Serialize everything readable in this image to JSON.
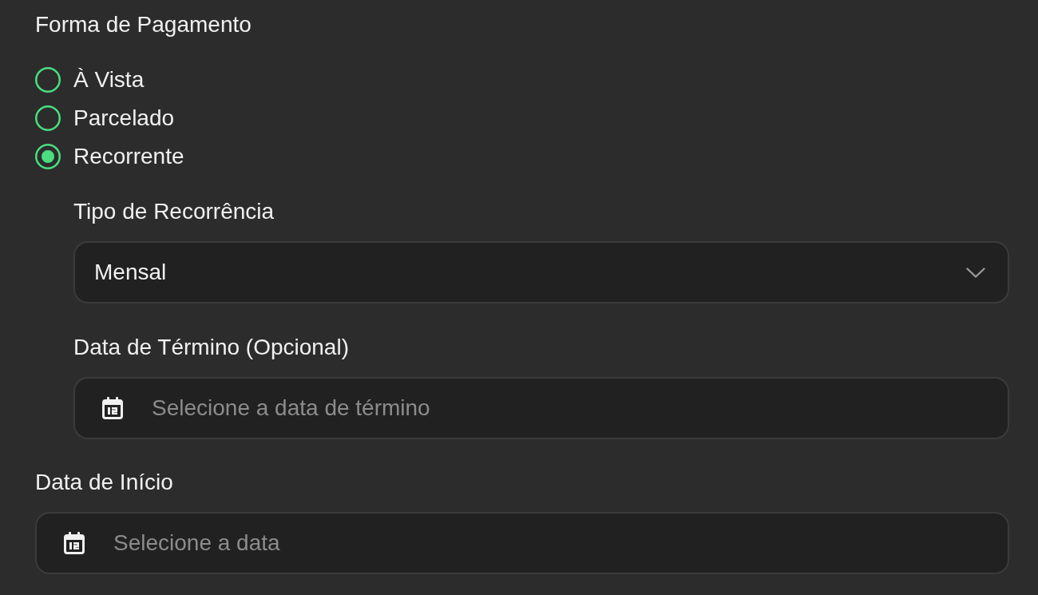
{
  "section": {
    "title": "Forma de Pagamento"
  },
  "payment_options": [
    {
      "label": "À Vista",
      "selected": false
    },
    {
      "label": "Parcelado",
      "selected": false
    },
    {
      "label": "Recorrente",
      "selected": true
    }
  ],
  "recurrence": {
    "type_label": "Tipo de Recorrência",
    "type_value": "Mensal",
    "end_date_label": "Data de Término (Opcional)",
    "end_date_placeholder": "Selecione a data de término"
  },
  "start_date": {
    "label": "Data de Início",
    "placeholder": "Selecione a data"
  }
}
